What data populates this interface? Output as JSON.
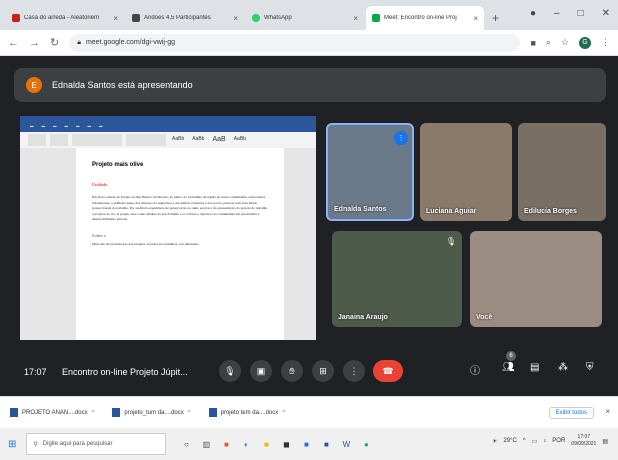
{
  "browser": {
    "tabs": [
      {
        "title": "Casa do arreda - Aleatoriem",
        "favicon_color": "#c5221f"
      },
      {
        "title": "Andoes 4,5 Participantes",
        "favicon_color": "#444444"
      },
      {
        "title": "WhatsApp",
        "favicon_color": "#25d366"
      },
      {
        "title": "Meet: Encontro on-line Proj",
        "favicon_color": "#00ac47",
        "active": true
      }
    ],
    "new_tab": "+",
    "url": "meet.google.com/dgi-vwij-gg",
    "profile_initial": "G"
  },
  "meet": {
    "presenter_banner": "Ednalda Santos está apresentando",
    "presenter_initial": "E",
    "shared_doc": {
      "title": "Projeto mais olive",
      "heading": "Unidade",
      "body": "Em nosso estudo do Projeto no Rio Branco de Maceio, no bairro do Jacintinho da região de nossa comunidade, observamos informações, o primeiro passo dos diversos da seguranca e dos ambos contextos e dos povos, pessoas com suas ideias proporcionais do trabalho. Por assim da experiência de preservação no rumo escolar e da apresentação do projeto do trabalho e projetos no rio. O projeto teve como direitos do seu domínio e os valores e objetivos da comunidade em sua matéria e desenvolvimento pessoal.",
      "subheading": "Sobre o",
      "body2": "Meio são dos professores dos projetos, levados dos trabalhos, nos interesses."
    },
    "participants": [
      {
        "name": "Ednalda Santos",
        "speaking": true
      },
      {
        "name": "Luciana Aguiar"
      },
      {
        "name": "Edilucia Borges"
      },
      {
        "name": "Janaina Araujo",
        "muted": true
      },
      {
        "name": "Você"
      }
    ],
    "time": "17:07",
    "meeting_title": "Encontro on-line Projeto Júpit...",
    "participant_count": "6"
  },
  "downloads": {
    "items": [
      "PROJETO ANAN....docx",
      "projeto_tum da....docx",
      "projeto tem da....docx"
    ],
    "show_all": "Exibir todos"
  },
  "taskbar": {
    "search_placeholder": "Digite aqui para pesquisar",
    "weather": "29°C",
    "lang": "POR",
    "time": "17:07",
    "date": "09/09/2021"
  }
}
